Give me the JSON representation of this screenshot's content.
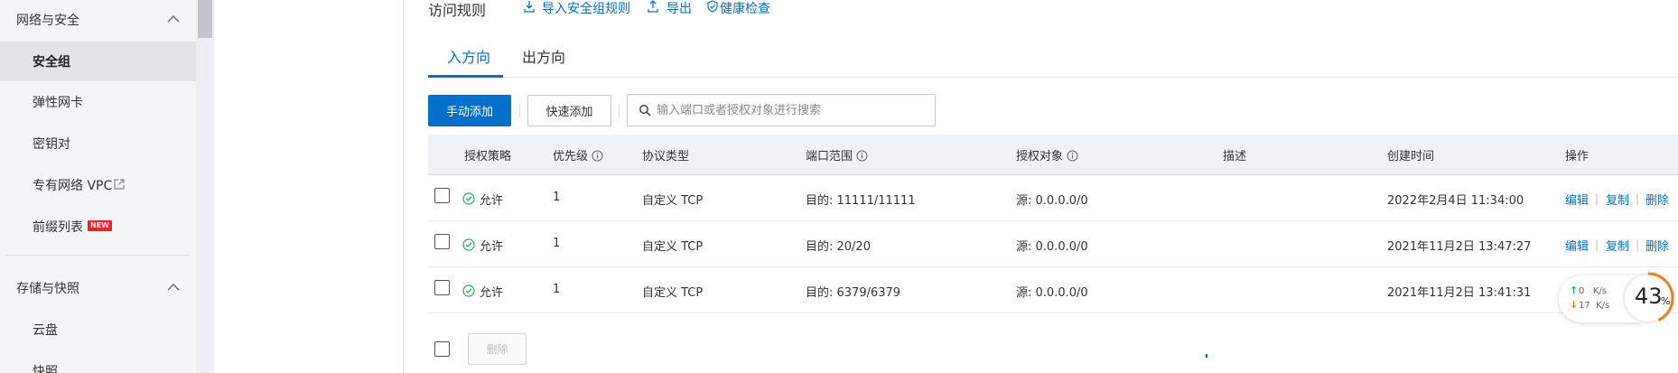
{
  "sidebar": {
    "groups": [
      {
        "label": "网络与安全"
      },
      {
        "label": "存储与快照"
      }
    ],
    "network_items": [
      {
        "label": "安全组"
      },
      {
        "label": "弹性网卡"
      },
      {
        "label": "密钥对"
      },
      {
        "label": "专有网络 VPC"
      },
      {
        "label": "前缀列表"
      }
    ],
    "storage_items": [
      {
        "label": "云盘"
      },
      {
        "label": "快照"
      }
    ],
    "new_badge": "NEW"
  },
  "header": {
    "title": "访问规则",
    "import_label": "导入安全组规则",
    "export_label": "导出",
    "health_label": "健康检查"
  },
  "tabs": [
    {
      "label": "入方向"
    },
    {
      "label": "出方向"
    }
  ],
  "toolbar": {
    "manual_add": "手动添加",
    "quick_add": "快速添加",
    "search_placeholder": "输入端口或者授权对象进行搜索"
  },
  "table": {
    "columns": [
      "授权策略",
      "优先级",
      "协议类型",
      "端口范围",
      "授权对象",
      "描述",
      "创建时间",
      "操作"
    ],
    "rows": [
      {
        "policy": "允许",
        "priority": "1",
        "protocol": "自定义 TCP",
        "port": "目的: 11111/11111",
        "source": "源: 0.0.0.0/0",
        "desc": "",
        "created": "2022年2月4日 11:34:00"
      },
      {
        "policy": "允许",
        "priority": "1",
        "protocol": "自定义 TCP",
        "port": "目的: 20/20",
        "source": "源: 0.0.0.0/0",
        "desc": "",
        "created": "2021年11月2日 13:47:27"
      },
      {
        "policy": "允许",
        "priority": "1",
        "protocol": "自定义 TCP",
        "port": "目的: 6379/6379",
        "source": "源: 0.0.0.0/0",
        "desc": "",
        "created": "2021年11月2日 13:41:31"
      }
    ],
    "actions": {
      "edit": "编辑",
      "copy": "复制",
      "delete": "删除"
    },
    "delete_button": "删除"
  },
  "net_widget": {
    "up_value": "0",
    "up_unit": "K/s",
    "down_value": "17",
    "down_unit": "K/s",
    "cpu_value": "43",
    "cpu_unit": "%",
    "cpu_fraction": 0.43
  },
  "colors": {
    "accent": "#0070cc",
    "allow_green": "#27ae60",
    "gauge_orange": "#f57c1f"
  }
}
